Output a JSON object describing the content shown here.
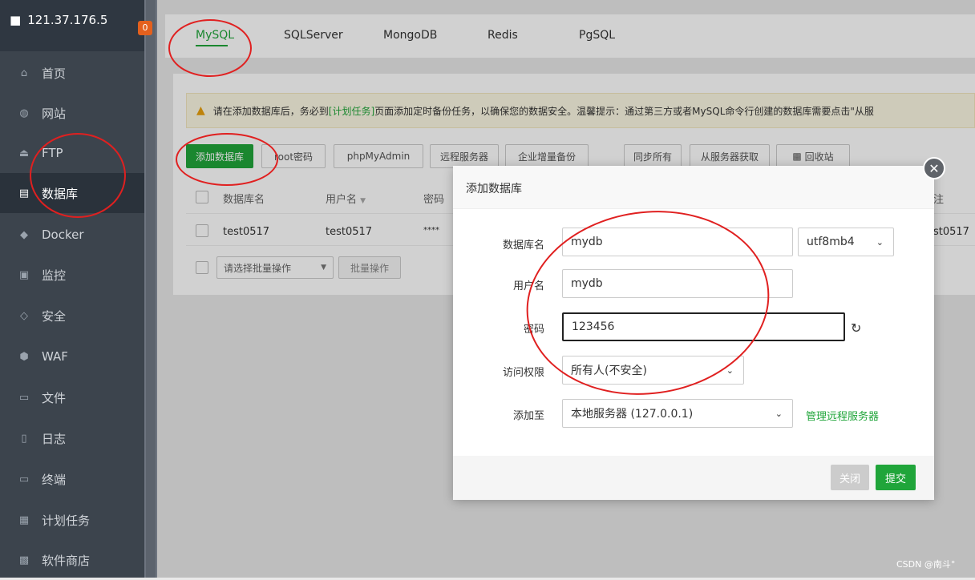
{
  "sidebar": {
    "server_ip": "121.37.176.5",
    "badge_count": "0",
    "items": [
      {
        "label": "首页",
        "icon": "home-icon"
      },
      {
        "label": "网站",
        "icon": "globe-icon"
      },
      {
        "label": "FTP",
        "icon": "ftp-icon"
      },
      {
        "label": "数据库",
        "icon": "database-icon"
      },
      {
        "label": "Docker",
        "icon": "docker-icon"
      },
      {
        "label": "监控",
        "icon": "monitor-icon"
      },
      {
        "label": "安全",
        "icon": "shield-icon"
      },
      {
        "label": "WAF",
        "icon": "waf-icon"
      },
      {
        "label": "文件",
        "icon": "folder-icon"
      },
      {
        "label": "日志",
        "icon": "log-icon"
      },
      {
        "label": "终端",
        "icon": "terminal-icon"
      },
      {
        "label": "计划任务",
        "icon": "calendar-icon"
      },
      {
        "label": "软件商店",
        "icon": "apps-icon"
      }
    ],
    "active_index": 3
  },
  "tabs": [
    "MySQL",
    "SQLServer",
    "MongoDB",
    "Redis",
    "PgSQL"
  ],
  "warning": {
    "prefix": "请在添加数据库后，务必到",
    "link": "[计划任务]",
    "suffix": "页面添加定时备份任务，以确保您的数据安全。温馨提示：通过第三方或者MySQL命令行创建的数据库需要点击\"从服"
  },
  "toolbar": {
    "add_db": "添加数据库",
    "root_pw": "root密码",
    "phpmyadmin": "phpMyAdmin",
    "remote": "远程服务器",
    "backup": "企业增量备份",
    "sync_all": "同步所有",
    "fetch": "从服务器获取",
    "recycle": "回收站"
  },
  "table": {
    "headers": {
      "name": "数据库名",
      "user": "用户名",
      "password": "密码",
      "note": "注"
    },
    "row": {
      "name": "test0517",
      "user": "test0517",
      "password": "****",
      "note": "st0517"
    }
  },
  "batch": {
    "select_placeholder": "请选择批量操作",
    "button": "批量操作"
  },
  "modal": {
    "title": "添加数据库",
    "fields": {
      "db_name_label": "数据库名",
      "db_name_value": "mydb",
      "charset": "utf8mb4",
      "user_label": "用户名",
      "user_value": "mydb",
      "password_label": "密码",
      "password_value": "123456",
      "access_label": "访问权限",
      "access_value": "所有人(不安全)",
      "add_to_label": "添加至",
      "add_to_value": "本地服务器 (127.0.0.1)",
      "manage_remote": "管理远程服务器"
    },
    "close_button": "关闭",
    "submit_button": "提交"
  },
  "watermark": "CSDN @南斗°",
  "colors": {
    "accent": "#20a53a",
    "sidebar": "#3c444d",
    "annotation": "#e02020"
  }
}
